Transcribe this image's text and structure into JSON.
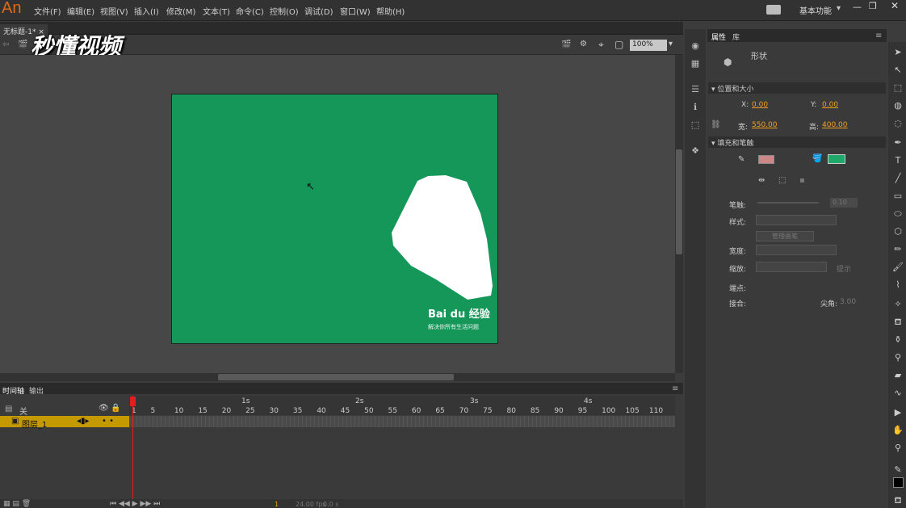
{
  "app": {
    "logo": "An",
    "workspace": "基本功能"
  },
  "menu": [
    "文件(F)",
    "编辑(E)",
    "视图(V)",
    "插入(I)",
    "修改(M)",
    "文本(T)",
    "命令(C)",
    "控制(O)",
    "调试(D)",
    "窗口(W)",
    "帮助(H)"
  ],
  "document": {
    "tab_title": "无标题-1*",
    "zoom": "100%"
  },
  "watermark": "秒懂视频",
  "stage": {
    "baidu_logo": "Bai du 经验",
    "baidu_slogan": "解决你所有生活问题"
  },
  "timeline": {
    "tabs": [
      "时间轴",
      "输出"
    ],
    "layer_header": "关",
    "layer_name": "图层_1",
    "seconds": [
      "1s",
      "2s",
      "3s",
      "4s"
    ],
    "frame_ticks": [
      "1",
      "5",
      "10",
      "15",
      "20",
      "25",
      "30",
      "35",
      "40",
      "45",
      "50",
      "55",
      "60",
      "65",
      "70",
      "75",
      "80",
      "85",
      "90",
      "95",
      "100",
      "105",
      "110"
    ],
    "fps": "24.00 fps",
    "time": "0.0 s",
    "current_frame": "1"
  },
  "properties": {
    "tabs": [
      "属性",
      "库"
    ],
    "object_type": "形状",
    "section_position": "位置和大小",
    "x_label": "X:",
    "x": "0.00",
    "y_label": "Y:",
    "y": "0.00",
    "w_label": "宽:",
    "w": "550.00",
    "h_label": "高:",
    "h": "400.00",
    "section_fill": "填充和笔触",
    "stroke_label": "笔触:",
    "stroke_value": "0.10",
    "style_label": "样式:",
    "manage_brush": "管理画笔",
    "width_label": "宽度:",
    "scale_label": "缩放:",
    "hint_label": "提示",
    "cap_label": "端点:",
    "join_label": "接合:",
    "miter_label": "尖角:",
    "miter_value": "3.00"
  },
  "colors": {
    "stage": "#15975a",
    "fill_swatch": "#1fa86a",
    "playhead": "#e02020",
    "layer_highlight": "#c49a00"
  }
}
